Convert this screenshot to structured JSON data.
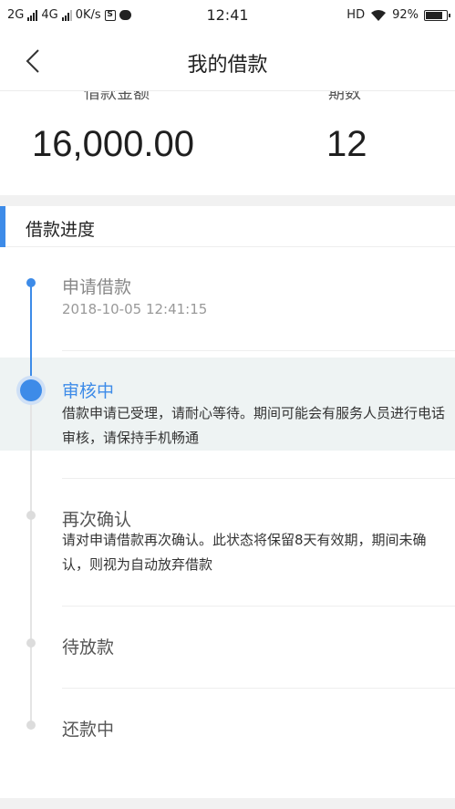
{
  "status_bar": {
    "left_network_1": "2G",
    "left_network_2": "4G",
    "speed": "0K/s",
    "time": "12:41",
    "hd": "HD",
    "battery": "92%",
    "battery_level": 0.92
  },
  "header": {
    "title": "我的借款",
    "back_icon": "chevron-left-icon"
  },
  "summary": {
    "amount_label": "借款金额",
    "amount_value": "16,000.00",
    "periods_label": "期数",
    "periods_value": "12"
  },
  "progress": {
    "section_title": "借款进度",
    "accent_color": "#3d8be8",
    "steps": [
      {
        "title": "申请借款",
        "timestamp": "2018-10-05 12:41:15",
        "state": "done"
      },
      {
        "title": "审核中",
        "description": "借款申请已受理，请耐心等待。期间可能会有服务人员进行电话审核，请保持手机畅通",
        "state": "current"
      },
      {
        "title": "再次确认",
        "description": "请对申请借款再次确认。此状态将保留8天有效期，期间未确认，则视为自动放弃借款",
        "state": "pending"
      },
      {
        "title": "待放款",
        "state": "pending"
      },
      {
        "title": "还款中",
        "state": "pending"
      }
    ]
  }
}
